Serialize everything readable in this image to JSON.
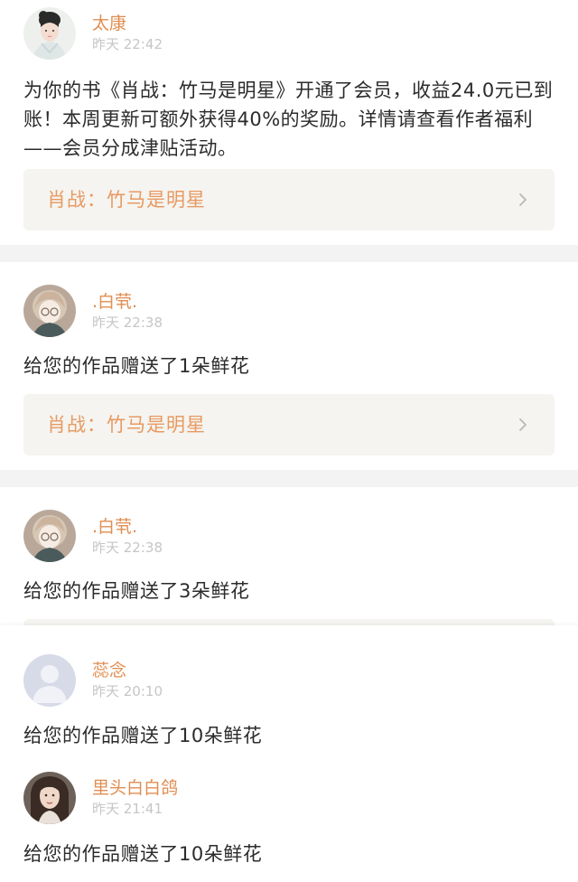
{
  "notifications": [
    {
      "user": "太康",
      "time": "昨天 22:42",
      "message": "为你的书《肖战：竹马是明星》开通了会员，收益24.0元已到账！本周更新可额外获得40%的奖励。详情请查看作者福利——会员分成津贴活动。",
      "book_title": "肖战：竹马是明星",
      "avatar_icon": "woman-portrait-avatar"
    },
    {
      "user": ".白茕.",
      "time": "昨天 22:38",
      "message": "给您的作品赠送了1朵鲜花",
      "book_title": "肖战：竹马是明星",
      "avatar_icon": "anime-girl-avatar"
    },
    {
      "user": ".白茕.",
      "time": "昨天 22:38",
      "message": "给您的作品赠送了3朵鲜花",
      "avatar_icon": "anime-girl-avatar"
    },
    {
      "user": "蕊念",
      "time": "昨天 20:10",
      "message": "给您的作品赠送了10朵鲜花",
      "avatar_icon": "default-person-avatar"
    },
    {
      "user": "里头白白鸽",
      "time": "昨天 21:41",
      "message": "给您的作品赠送了10朵鲜花",
      "avatar_icon": "girl-photo-avatar"
    }
  ],
  "colors": {
    "name": "#e08e52",
    "time": "#c6c6c6",
    "book_title": "#e89a62",
    "book_bg": "#f5f4f0",
    "separator": "#f3f3f3"
  }
}
